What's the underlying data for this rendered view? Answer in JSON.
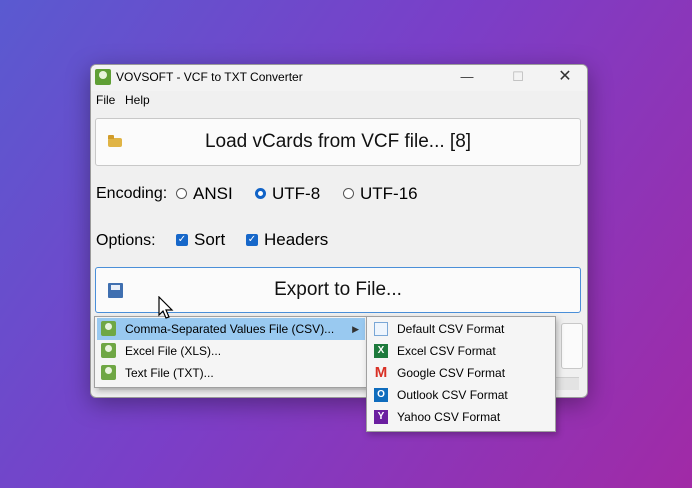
{
  "window": {
    "title": "VOVSOFT - VCF to TXT Converter",
    "controls": {
      "minimize": "—",
      "maximize": "☐",
      "close": "✕"
    }
  },
  "menubar": {
    "file": "File",
    "help": "Help"
  },
  "load_button": {
    "label": "Load vCards from VCF file... [8]"
  },
  "encoding": {
    "label": "Encoding:",
    "options": [
      "ANSI",
      "UTF-8",
      "UTF-16"
    ],
    "selected": "UTF-8"
  },
  "options": {
    "label": "Options:",
    "items": [
      {
        "label": "Sort",
        "checked": true
      },
      {
        "label": "Headers",
        "checked": true
      }
    ]
  },
  "export_button": {
    "label": "Export to File..."
  },
  "export_menu": {
    "items": [
      {
        "label": "Comma-Separated Values File (CSV)...",
        "active": true,
        "has_submenu": true
      },
      {
        "label": "Excel File (XLS)...",
        "active": false
      },
      {
        "label": "Text File (TXT)...",
        "active": false
      }
    ],
    "arrow": "▶"
  },
  "csv_submenu": {
    "items": [
      {
        "label": "Default CSV Format",
        "icon": "csv-icon"
      },
      {
        "label": "Excel CSV Format",
        "icon": "excel-icon"
      },
      {
        "label": "Google CSV Format",
        "icon": "gmail-icon"
      },
      {
        "label": "Outlook CSV Format",
        "icon": "outlook-icon"
      },
      {
        "label": "Yahoo CSV Format",
        "icon": "yahoo-icon"
      }
    ]
  }
}
